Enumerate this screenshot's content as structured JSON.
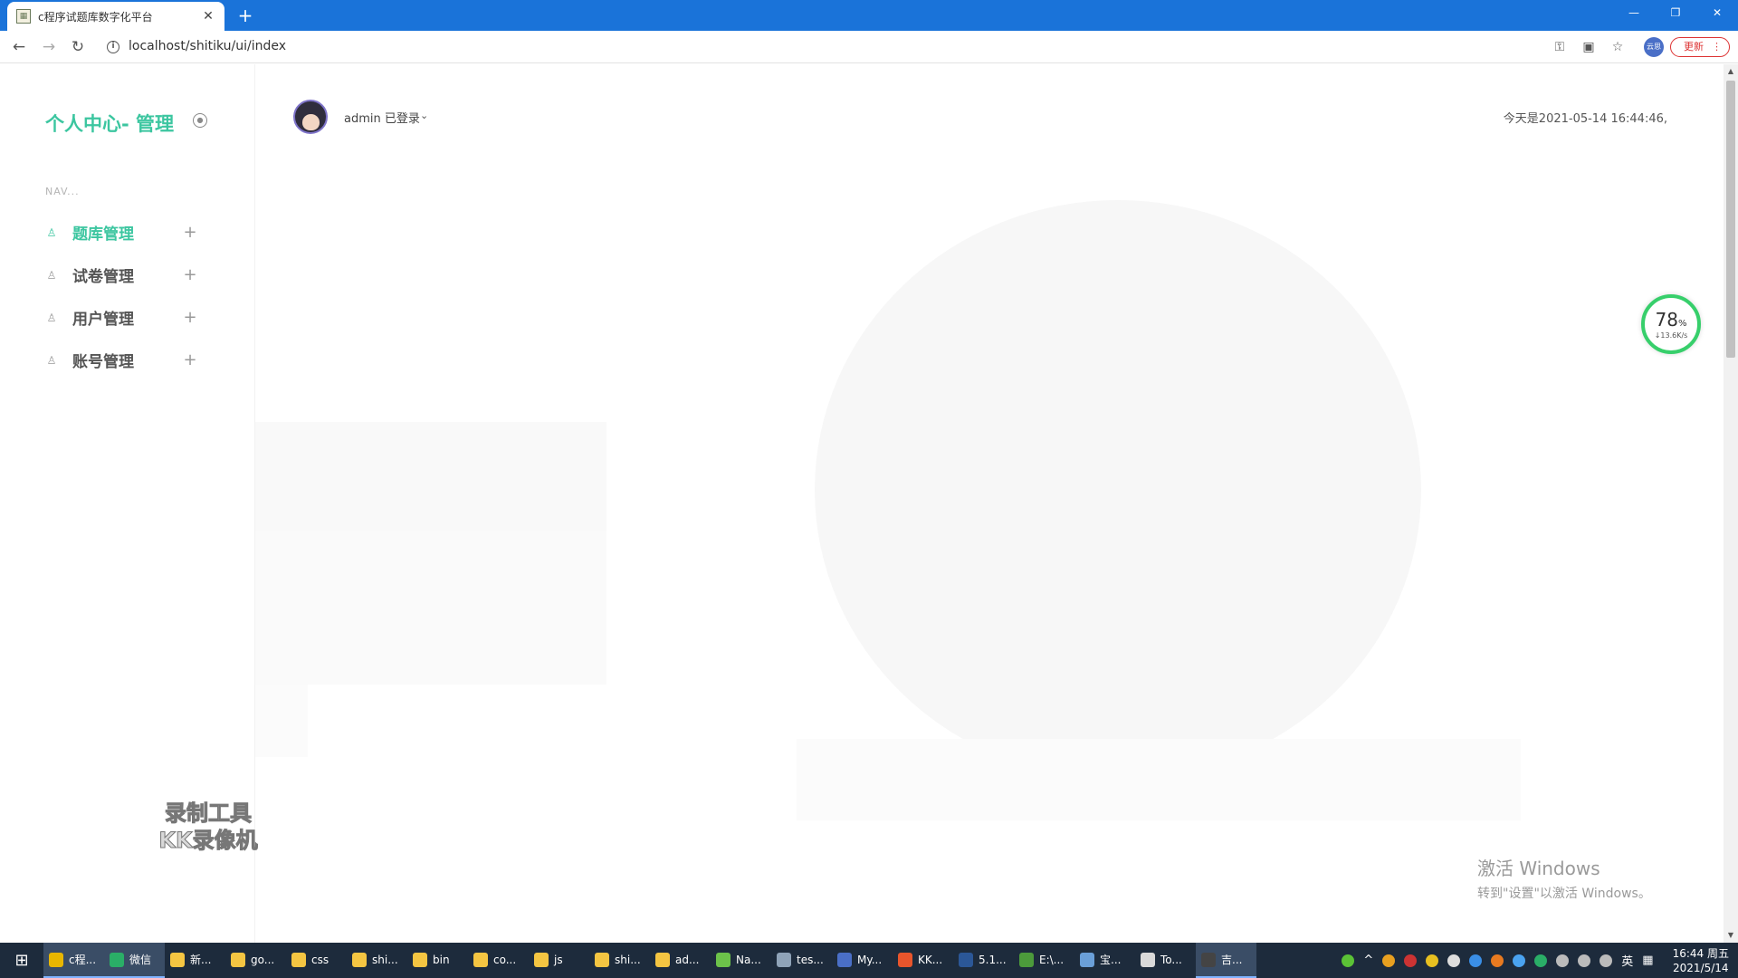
{
  "browser": {
    "tab_title": "c程序试题库数字化平台",
    "url": "localhost/shitiku/ui/index",
    "profile_label": "云思",
    "update_label": "更新"
  },
  "sidebar": {
    "brand": "个人中心- 管理",
    "nav_heading": "NAV...",
    "items": [
      {
        "label": "题库管理",
        "active": true
      },
      {
        "label": "试卷管理",
        "active": false
      },
      {
        "label": "用户管理",
        "active": false
      },
      {
        "label": "账号管理",
        "active": false
      }
    ]
  },
  "header": {
    "user_label": "admin 已登录",
    "datetime": "今天是2021-05-14 16:44:46,"
  },
  "network_gauge": {
    "percent": "78",
    "unit": "%",
    "speed": "↓13.6K/s",
    "color": "#37cf6b"
  },
  "watermark": {
    "line1": "录制工具",
    "line2": "KK录像机"
  },
  "activation": {
    "title": "激活 Windows",
    "subtitle": "转到\"设置\"以激活 Windows。"
  },
  "taskbar": {
    "items": [
      {
        "label": "c程...",
        "icon": "chrome-icon",
        "color": "#e8b600",
        "active": true
      },
      {
        "label": "微信",
        "icon": "wechat-icon",
        "color": "#2aae67",
        "active": true
      },
      {
        "label": "新...",
        "icon": "folder-icon",
        "color": "#f4c542",
        "active": false
      },
      {
        "label": "go...",
        "icon": "folder-icon",
        "color": "#f4c542",
        "active": false
      },
      {
        "label": "css",
        "icon": "folder-icon",
        "color": "#f4c542",
        "active": false
      },
      {
        "label": "shi...",
        "icon": "folder-icon",
        "color": "#f4c542",
        "active": false
      },
      {
        "label": "bin",
        "icon": "folder-icon",
        "color": "#f4c542",
        "active": false
      },
      {
        "label": "co...",
        "icon": "folder-icon",
        "color": "#f4c542",
        "active": false
      },
      {
        "label": "js",
        "icon": "folder-icon",
        "color": "#f4c542",
        "active": false
      },
      {
        "label": "shi...",
        "icon": "folder-icon",
        "color": "#f4c542",
        "active": false
      },
      {
        "label": "ad...",
        "icon": "folder-icon",
        "color": "#f4c542",
        "active": false
      },
      {
        "label": "Na...",
        "icon": "navicat-icon",
        "color": "#6cc24a",
        "active": false
      },
      {
        "label": "tes...",
        "icon": "app-icon",
        "color": "#8fa3b8",
        "active": false
      },
      {
        "label": "My...",
        "icon": "myeclipse-icon",
        "color": "#4a6fc7",
        "active": false
      },
      {
        "label": "KK...",
        "icon": "kk-recorder-icon",
        "color": "#e8552c",
        "active": false
      },
      {
        "label": "5.1...",
        "icon": "word-icon",
        "color": "#2b5797",
        "active": false
      },
      {
        "label": "E:\\...",
        "icon": "excel-icon",
        "color": "#4c9a3b",
        "active": false
      },
      {
        "label": "宝...",
        "icon": "app-icon",
        "color": "#6a9fd8",
        "active": false
      },
      {
        "label": "To...",
        "icon": "java-icon",
        "color": "#d9d9d9",
        "active": false
      },
      {
        "label": "吉...",
        "icon": "app-icon",
        "color": "#444444",
        "active": true
      }
    ],
    "ime": "英",
    "time": "16:44 周五",
    "date": "2021/5/14"
  }
}
